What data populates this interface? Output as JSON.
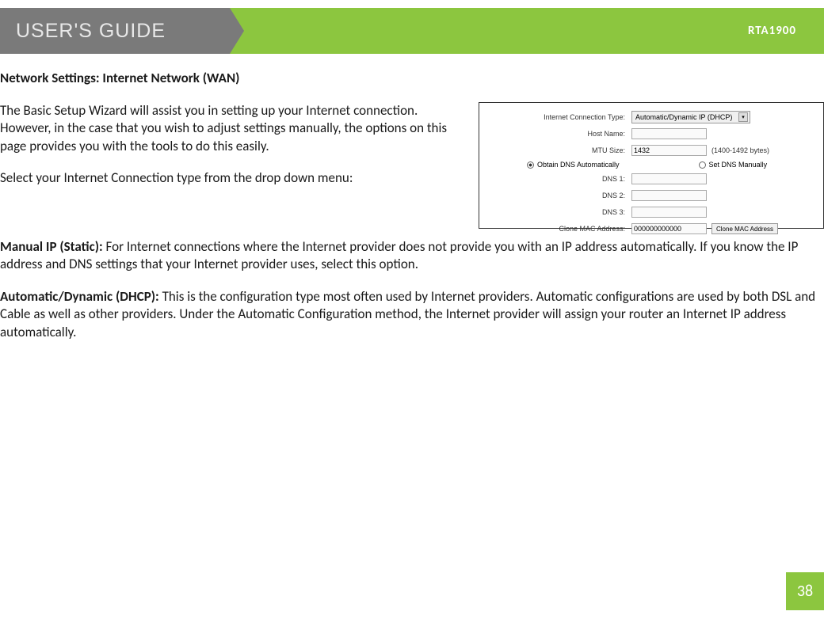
{
  "header": {
    "title": "USER'S GUIDE",
    "model": "RTA1900"
  },
  "section_title": "Network Settings: Internet Network (WAN)",
  "paragraphs": {
    "intro": "The Basic Setup Wizard will assist you in setting up your Internet connection. However, in the case that you wish to adjust settings manually, the options on this page provides you with the tools to do this easily.",
    "select_prompt": "Select your Internet Connection type from the drop down menu:",
    "manual_ip_label": "Manual IP (Static):",
    "manual_ip_body": " For Internet connections where the Internet provider does not provide you with an IP address automatically. If you know the IP address and DNS settings that your Internet provider uses, select this option.",
    "dhcp_label": "Automatic/Dynamic (DHCP):",
    "dhcp_body": " This is the configuration type most often used by Internet providers. Automatic configurations are used by both DSL and Cable as well as other providers. Under the Automatic Configuration method, the Internet provider will assign your router an Internet IP address automatically."
  },
  "screenshot": {
    "labels": {
      "conn_type": "Internet Connection Type:",
      "host_name": "Host Name:",
      "mtu": "MTU Size:",
      "dns1": "DNS 1:",
      "dns2": "DNS 2:",
      "dns3": "DNS 3:",
      "clone_mac": "Clone MAC Address:"
    },
    "values": {
      "conn_type_selected": "Automatic/Dynamic IP (DHCP)",
      "host_name": "",
      "mtu": "1432",
      "mtu_hint": "(1400-1492 bytes)",
      "clone_mac": "000000000000",
      "clone_btn": "Clone MAC Address"
    },
    "radio": {
      "auto": "Obtain DNS Automatically",
      "manual": "Set DNS Manually"
    }
  },
  "page_number": "38"
}
